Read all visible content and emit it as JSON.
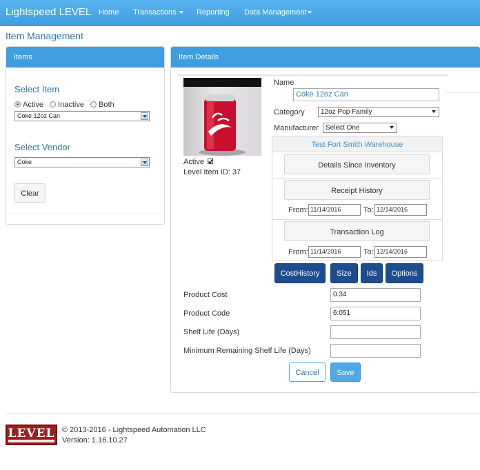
{
  "nav": {
    "brand": "Lightspeed LEVEL",
    "items": [
      "Home",
      "Transactions",
      "Reporting",
      "Data Management"
    ]
  },
  "page_title": "Item Management",
  "items_panel": {
    "title": "Items",
    "select_item_label": "Select Item",
    "radios": [
      {
        "label": "Active",
        "checked": true
      },
      {
        "label": "Inactive",
        "checked": false
      },
      {
        "label": "Both",
        "checked": false
      }
    ],
    "item_value": "Coke 12oz Can",
    "select_vendor_label": "Select Vendor",
    "vendor_value": "Coke",
    "clear_label": "Clear"
  },
  "details": {
    "title": "Item Details",
    "name_label": "Name",
    "name_value": "Coke 12oz Can",
    "category_label": "Category",
    "category_value": "12oz Pop Family",
    "manufacturer_label": "Manufacturer",
    "manufacturer_value": "Select One",
    "active_label": "Active",
    "level_id_text": "Level Item ID: 37",
    "warehouse": "Test Fort Smith Warehouse",
    "details_since_inventory": "Details Since Inventory",
    "receipt_history": "Receipt History",
    "transaction_log": "Transaction Log",
    "from_label": "From:",
    "to_label": "To:",
    "receipt_from": "11/14/2016",
    "receipt_to": "12/14/2016",
    "log_from": "11/14/2016",
    "log_to": "12/14/2016",
    "buttons": [
      "CostHistory",
      "Size",
      "Ids",
      "Options"
    ],
    "fields": [
      {
        "label": "Product Cost",
        "value": "0.34"
      },
      {
        "label": "Product Code",
        "value": "6:051"
      },
      {
        "label": "Shelf Life (Days)",
        "value": ""
      },
      {
        "label": "Minimum Remaining Shelf Life (Days)",
        "value": ""
      }
    ],
    "cancel_label": "Cancel",
    "save_label": "Save"
  },
  "footer": {
    "logo_text": "LEVEL",
    "copyright": "© 2013-2016 - Lightspeed Automation LLC",
    "version": "Version: 1.16.10.27"
  },
  "colors": {
    "navbar": "#4ea9e6",
    "panel_header": "#3e9edf",
    "dark_button": "#1e4d8f",
    "logo": "#9e1f1f"
  }
}
